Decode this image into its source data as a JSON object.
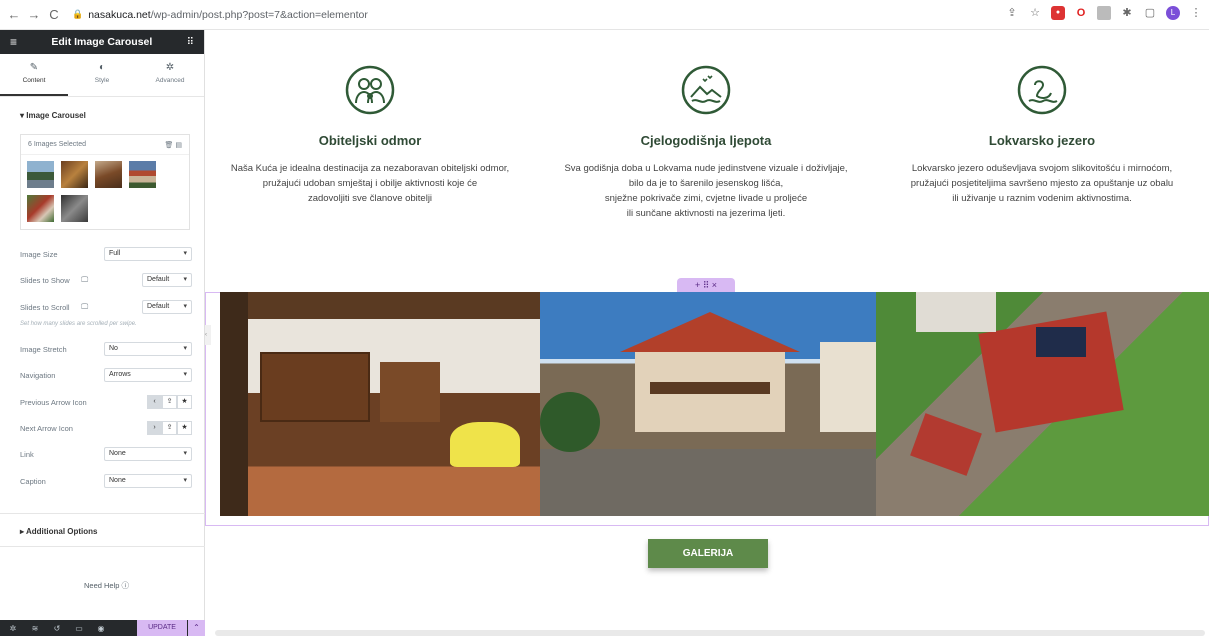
{
  "browser": {
    "back": "←",
    "forward": "→",
    "reload": "C",
    "url_host": "nasakuca.net",
    "url_path": "/wp-admin/post.php?post=7&action=elementor"
  },
  "panel": {
    "title": "Edit Image Carousel",
    "tabs": [
      {
        "label": "Content",
        "icon": "✎"
      },
      {
        "label": "Style",
        "icon": "◐"
      },
      {
        "label": "Advanced",
        "icon": "✲"
      }
    ],
    "section_title": "Image Carousel",
    "gallery_label": "6 Images Selected",
    "controls": [
      {
        "label": "Image Size",
        "value": "Full"
      },
      {
        "label": "Slides to Show",
        "value": "Default"
      },
      {
        "label": "Slides to Scroll",
        "value": "Default"
      },
      {
        "label": "Image Stretch",
        "value": "No"
      },
      {
        "label": "Navigation",
        "value": "Arrows"
      },
      {
        "label": "Previous Arrow Icon"
      },
      {
        "label": "Next Arrow Icon"
      },
      {
        "label": "Link",
        "value": "None"
      },
      {
        "label": "Caption",
        "value": "None"
      }
    ],
    "hint": "Set how many slides are scrolled per swipe.",
    "additional_options": "Additional Options",
    "need_help": "Need Help",
    "update": "UPDATE"
  },
  "features": [
    {
      "title": "Obiteljski odmor",
      "lines": [
        "Naša Kuća je idealna destinacija za nezaboravan obiteljski odmor,",
        "pružajući udoban smještaj i obilje aktivnosti koje će",
        "zadovoljiti sve članove obitelji"
      ]
    },
    {
      "title": "Cjelogodišnja ljepota",
      "lines": [
        "Sva godišnja doba u Lokvama nude jedinstvene vizuale i doživljaje,",
        "bilo da je to šarenilo jesenskog lišća,",
        "snježne pokrivače zimi, cvjetne livade u proljeće",
        "ili sunčane aktivnosti na jezerima ljeti."
      ]
    },
    {
      "title": "Lokvarsko jezero",
      "lines": [
        "Lokvarsko jezero oduševljava svojom slikovitošću i mirnoćom,",
        "pružajući posjetiteljima savršeno mjesto za opuštanje uz obalu",
        "ili uživanje u raznim vodenim aktivnostima."
      ]
    }
  ],
  "handle": "+ ⠿ ×",
  "gallery_button": "GALERIJA",
  "colors": {
    "accent_green": "#2f5a36",
    "button_green": "#5e8a4a",
    "elementor_pink": "#d8b9f3",
    "panel_dark": "#26292c"
  }
}
